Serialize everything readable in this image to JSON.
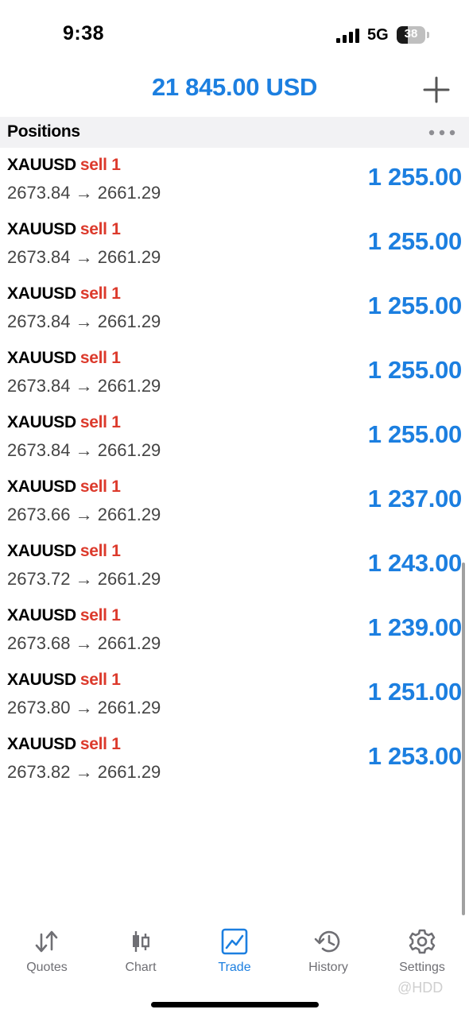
{
  "status_bar": {
    "time": "9:38",
    "network": "5G",
    "battery": "38",
    "battery_level": 0.38
  },
  "header": {
    "balance": "21 845.00 USD",
    "add_icon": "plus-icon"
  },
  "positions": {
    "title": "Positions",
    "more_icon": "more-dots-icon",
    "rows": [
      {
        "symbol": "XAUUSD",
        "side": "sell 1",
        "open_price": "2673.84",
        "current_price": "2661.29",
        "profit": "1 255.00"
      },
      {
        "symbol": "XAUUSD",
        "side": "sell 1",
        "open_price": "2673.84",
        "current_price": "2661.29",
        "profit": "1 255.00"
      },
      {
        "symbol": "XAUUSD",
        "side": "sell 1",
        "open_price": "2673.84",
        "current_price": "2661.29",
        "profit": "1 255.00"
      },
      {
        "symbol": "XAUUSD",
        "side": "sell 1",
        "open_price": "2673.84",
        "current_price": "2661.29",
        "profit": "1 255.00"
      },
      {
        "symbol": "XAUUSD",
        "side": "sell 1",
        "open_price": "2673.84",
        "current_price": "2661.29",
        "profit": "1 255.00"
      },
      {
        "symbol": "XAUUSD",
        "side": "sell 1",
        "open_price": "2673.66",
        "current_price": "2661.29",
        "profit": "1 237.00"
      },
      {
        "symbol": "XAUUSD",
        "side": "sell 1",
        "open_price": "2673.72",
        "current_price": "2661.29",
        "profit": "1 243.00"
      },
      {
        "symbol": "XAUUSD",
        "side": "sell 1",
        "open_price": "2673.68",
        "current_price": "2661.29",
        "profit": "1 239.00"
      },
      {
        "symbol": "XAUUSD",
        "side": "sell 1",
        "open_price": "2673.80",
        "current_price": "2661.29",
        "profit": "1 251.00"
      },
      {
        "symbol": "XAUUSD",
        "side": "sell 1",
        "open_price": "2673.82",
        "current_price": "2661.29",
        "profit": "1 253.00"
      }
    ]
  },
  "tabs": [
    {
      "label": "Quotes",
      "icon": "quotes-arrows-icon",
      "active": false
    },
    {
      "label": "Chart",
      "icon": "candlestick-chart-icon",
      "active": false
    },
    {
      "label": "Trade",
      "icon": "trade-chart-icon",
      "active": true
    },
    {
      "label": "History",
      "icon": "history-clock-icon",
      "active": false
    },
    {
      "label": "Settings",
      "icon": "gear-icon",
      "active": false
    }
  ],
  "watermark": "@HDD",
  "colors": {
    "accent": "#1c7fe0",
    "sell": "#dc3a2c",
    "tab_inactive": "#6f6f74"
  }
}
